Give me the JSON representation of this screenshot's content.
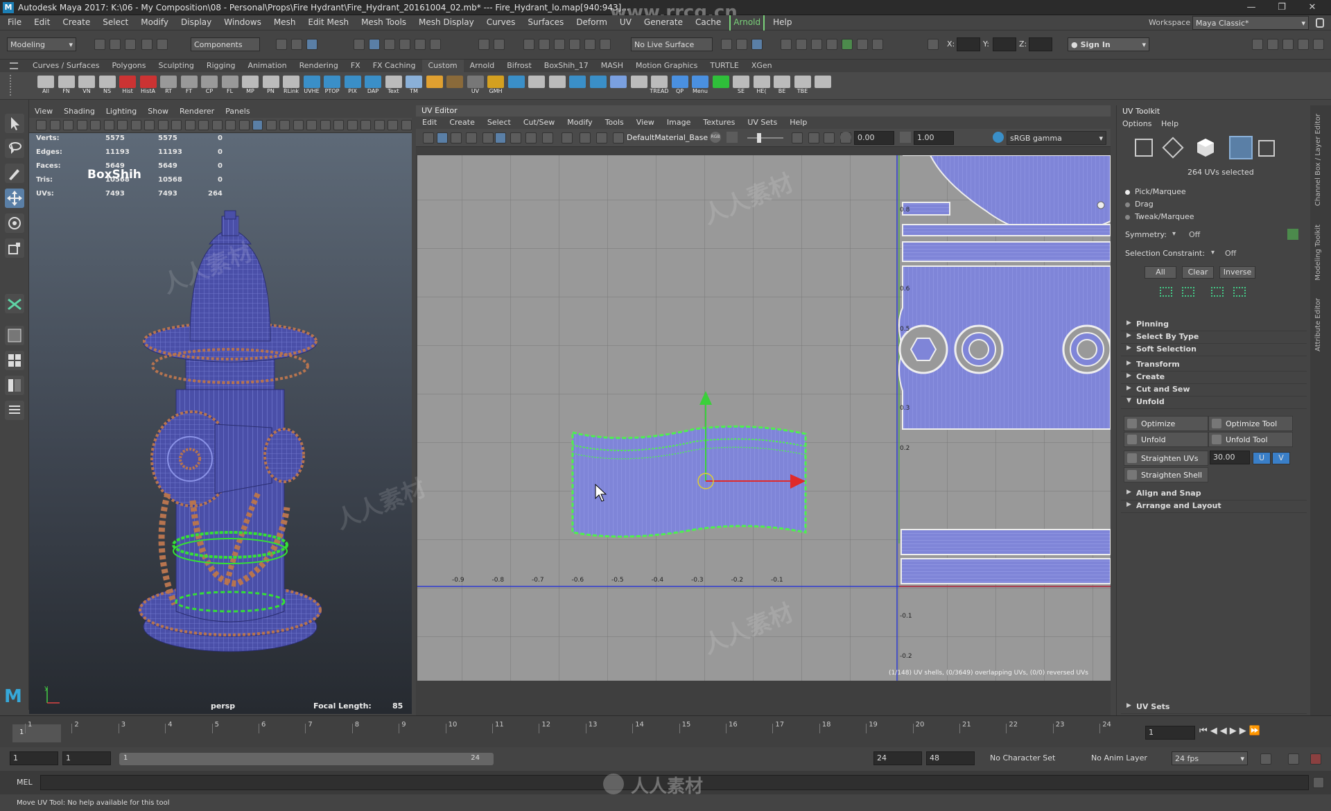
{
  "window": {
    "title": "Autodesk Maya 2017: K:\\06 - My Composition\\08 - Personal\\Props\\Fire Hydrant\\Fire_Hydrant_20161004_02.mb*  ---  Fire_Hydrant_lo.map[940:943]...",
    "logo": "M",
    "watermark_top": "www.rrcg.cn",
    "watermark_bottom": "人人素材",
    "workspace_label": "Workspace :",
    "workspace_value": "Maya Classic*"
  },
  "menubar": [
    "File",
    "Edit",
    "Create",
    "Select",
    "Modify",
    "Display",
    "Windows",
    "Mesh",
    "Edit Mesh",
    "Mesh Tools",
    "Mesh Display",
    "Curves",
    "Surfaces",
    "Deform",
    "UV",
    "Generate",
    "Cache",
    "Arnold",
    "Help"
  ],
  "status": {
    "mode": "Modeling",
    "components": "Components",
    "live_surface": "No Live Surface",
    "x_label": "X:",
    "y_label": "Y:",
    "z_label": "Z:",
    "sign_in": "Sign In"
  },
  "shelf_tabs": [
    "Curves / Surfaces",
    "Polygons",
    "Sculpting",
    "Rigging",
    "Animation",
    "Rendering",
    "FX",
    "FX Caching",
    "Custom",
    "Arnold",
    "Bifrost",
    "BoxShih_17",
    "MASH",
    "Motion Graphics",
    "TURTLE",
    "XGen"
  ],
  "shelf_icons": [
    "All",
    "FN",
    "VN",
    "NS",
    "Hist",
    "HistA",
    "RT",
    "FT",
    "CP",
    "FL",
    "MP",
    "PN",
    "RLink",
    "UVHE",
    "PTOP",
    "PIX",
    "DAP",
    "Text",
    "TM",
    "",
    "",
    "UV",
    "GMH",
    "",
    "",
    "",
    "",
    "",
    "",
    "",
    "TREAD",
    "QP",
    "Menu",
    "",
    "SE",
    "HE(",
    "BE",
    "TBE",
    ""
  ],
  "viewport": {
    "menus": [
      "View",
      "Shading",
      "Lighting",
      "Show",
      "Renderer",
      "Panels"
    ],
    "hud_rows": [
      {
        "label": "Verts:",
        "a": "5575",
        "b": "5575",
        "c": "0"
      },
      {
        "label": "Edges:",
        "a": "11193",
        "b": "11193",
        "c": "0"
      },
      {
        "label": "Faces:",
        "a": "5649",
        "b": "5649",
        "c": "0"
      },
      {
        "label": "Tris:",
        "a": "10568",
        "b": "10568",
        "c": "0"
      },
      {
        "label": "UVs:",
        "a": "7493",
        "b": "7493",
        "c": "264"
      }
    ],
    "overlay_name": "BoxShih",
    "camera": "persp",
    "focal_label": "Focal Length:",
    "focal_value": "85"
  },
  "uv_editor": {
    "title": "UV Editor",
    "menus": [
      "Edit",
      "Create",
      "Select",
      "Cut/Sew",
      "Modify",
      "Tools",
      "View",
      "Image",
      "Textures",
      "UV Sets",
      "Help"
    ],
    "material": "DefaultMaterial_Base",
    "exposure": "0.00",
    "gamma": "1.00",
    "colorspace": "sRGB gamma",
    "x_ticks": [
      "-0.9",
      "-0.8",
      "-0.7",
      "-0.6",
      "-0.5",
      "-0.4",
      "-0.3",
      "-0.2",
      "-0.1"
    ],
    "y_ticks": [
      "0.8",
      "0.6",
      "0.5",
      "0.3",
      "0.2",
      "-0.1",
      "-0.2"
    ],
    "status": "(1/148) UV shells, (0/3649) overlapping UVs, (0/0) reversed UVs"
  },
  "uv_toolkit": {
    "title": "UV Toolkit",
    "menus": [
      "Options",
      "Help"
    ],
    "selected": "264 UVs selected",
    "modes": [
      "Pick/Marquee",
      "Drag",
      "Tweak/Marquee"
    ],
    "symmetry_label": "Symmetry:",
    "symmetry_value": "Off",
    "constraint_label": "Selection Constraint:",
    "constraint_value": "Off",
    "buttons": [
      "All",
      "Clear",
      "Inverse"
    ],
    "sections_top": [
      "Pinning",
      "Select By Type",
      "Soft Selection"
    ],
    "sections": [
      "Transform",
      "Create",
      "Cut and Sew"
    ],
    "unfold_section": "Unfold",
    "unfold_buttons": [
      "Optimize",
      "Optimize Tool",
      "Unfold",
      "Unfold Tool"
    ],
    "straighten_uvs": "Straighten UVs",
    "straighten_value": "30.00",
    "u": "U",
    "v": "V",
    "straighten_shell": "Straighten Shell",
    "sections_bottom": [
      "Align and Snap",
      "Arrange and Layout"
    ],
    "uv_sets": "UV Sets"
  },
  "side_tabs": [
    "Channel Box / Layer Editor",
    "Modeling Toolkit",
    "Attribute Editor"
  ],
  "timeline": {
    "ticks": [
      "1",
      "2",
      "3",
      "4",
      "5",
      "6",
      "7",
      "8",
      "9",
      "10",
      "11",
      "12",
      "13",
      "14",
      "15",
      "16",
      "17",
      "18",
      "19",
      "20",
      "21",
      "22",
      "23",
      "24"
    ],
    "current_frame": "1",
    "range_start": "1",
    "range_start2": "1",
    "slider_start": "1",
    "slider_end": "24",
    "range_end": "24",
    "range_end2": "48",
    "char_set": "No Character Set",
    "anim_layer": "No Anim Layer",
    "fps": "24 fps"
  },
  "cmdline": {
    "lang": "MEL"
  },
  "help_line": "Move UV Tool: No help available for this tool"
}
